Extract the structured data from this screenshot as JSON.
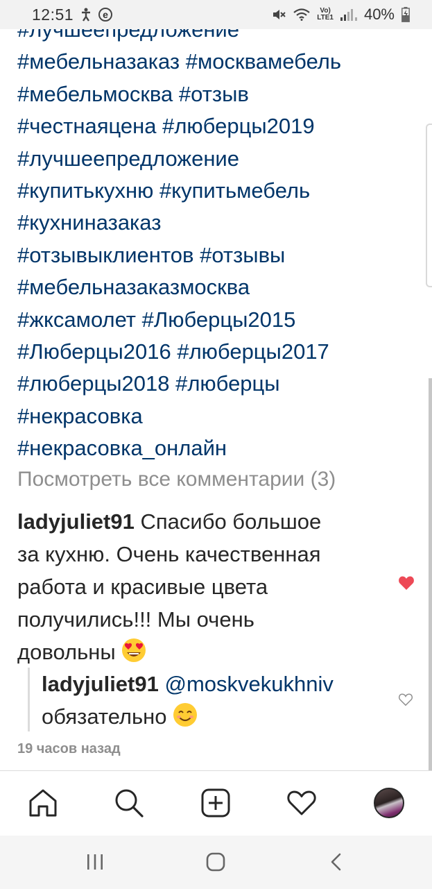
{
  "status_bar": {
    "time": "12:51",
    "battery": "40%",
    "lte_top": "Vo)",
    "lte_bottom": "LTE1"
  },
  "post": {
    "hashtags": [
      "#лучшеепредложение",
      "#мебельназаказ #москвамебель",
      "#мебельмосква #отзыв",
      "#честнаяцена #люберцы2019",
      "#лучшеепредложение",
      "#купитькухню #купитьмебель",
      "#кухниназаказ",
      "#отзывыклиентов #отзывы",
      "#мебельназаказмосква",
      "#жксамолет #Люберцы2015",
      "#Люберцы2016 #люберцы2017",
      "#люберцы2018 #люберцы",
      "#некрасовка",
      "#некрасовка_онлайн"
    ],
    "view_all_comments": "Посмотреть все комментарии (3)",
    "comment": {
      "username": "ladyjuliet91",
      "lines": [
        " Спасибо большое",
        "за кухню. Очень качественная",
        "работа и красивые цвета",
        "получились!!! Мы очень",
        "довольны"
      ],
      "emoji": "heart-eyes-emoji",
      "liked": true
    },
    "reply": {
      "username": "ladyjuliet91",
      "mention": "@moskvekukhniv",
      "text": "обязательно",
      "emoji": "smiling-face-emoji",
      "liked": false
    },
    "timestamp": "19 часов назад"
  },
  "colors": {
    "hashtag": "#003569",
    "muted": "#8e8e8e",
    "like": "#ed4956",
    "text": "#262626"
  },
  "bottom_nav": [
    "home-icon",
    "search-icon",
    "add-post-icon",
    "activity-heart-icon",
    "profile-avatar"
  ],
  "system_nav": [
    "recent-apps-icon",
    "home-button-icon",
    "back-icon"
  ]
}
